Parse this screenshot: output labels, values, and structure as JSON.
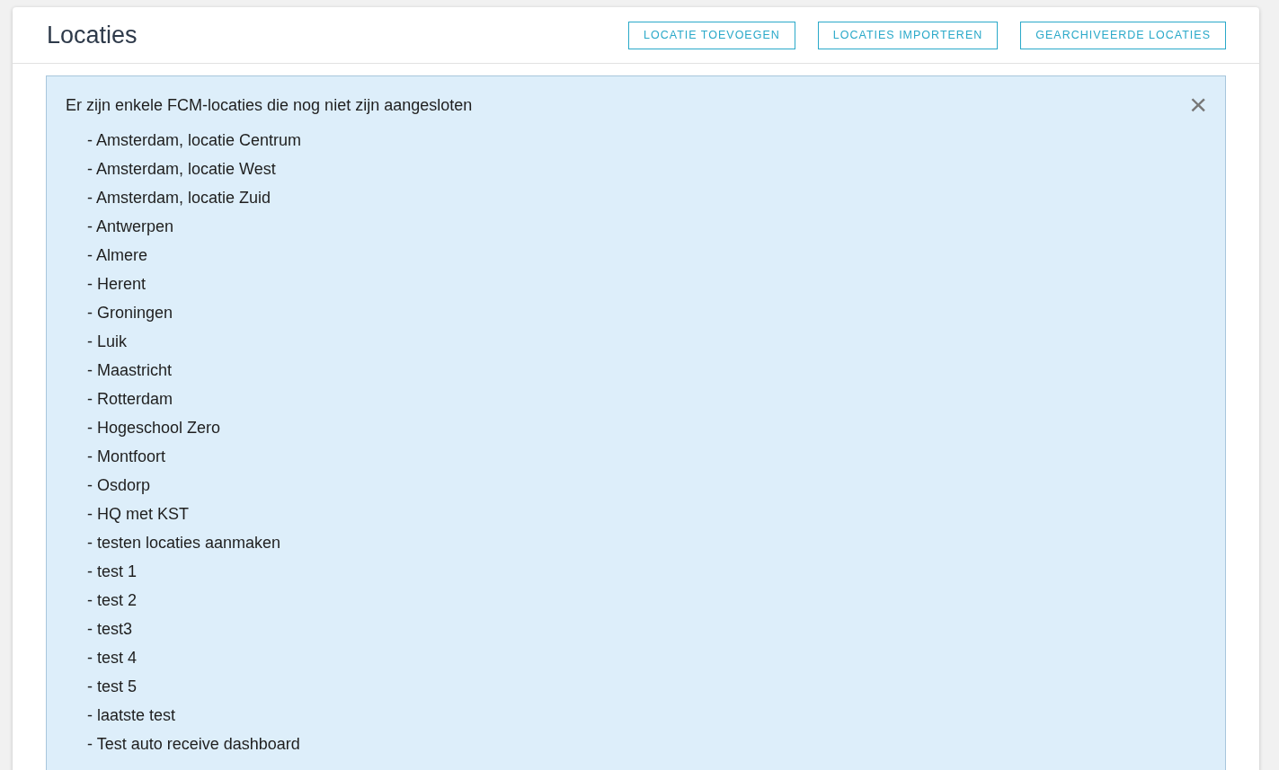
{
  "header": {
    "title": "Locaties",
    "buttons": [
      "LOCATIE TOEVOEGEN",
      "LOCATIES IMPORTEREN",
      "GEARCHIVEERDE LOCATIES"
    ]
  },
  "alert": {
    "message": "Er zijn enkele FCM-locaties die nog niet zijn aangesloten",
    "close": "×",
    "items": [
      "- Amsterdam, locatie Centrum",
      "- Amsterdam, locatie West",
      "- Amsterdam, locatie Zuid",
      "- Antwerpen",
      "- Almere",
      "- Herent",
      "- Groningen",
      "- Luik",
      "- Maastricht",
      "- Rotterdam",
      "- Hogeschool Zero",
      "- Montfoort",
      "- Osdorp",
      "- HQ met KST",
      "- testen locaties aanmaken",
      "- test 1",
      "- test 2",
      "- test3",
      "- test 4",
      "- test 5",
      "- laatste test",
      "- Test auto receive dashboard"
    ]
  }
}
